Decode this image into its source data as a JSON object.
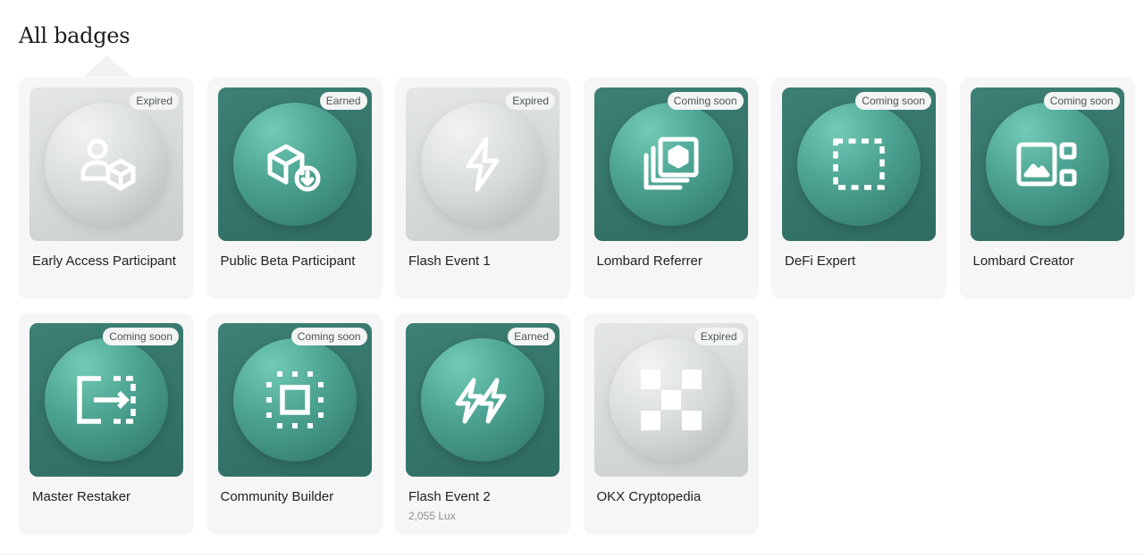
{
  "title": "All badges",
  "colors": {
    "accent": "#3d8074",
    "card_bg": "#f6f6f6",
    "pill_bg": "#f3f4f4"
  },
  "badges": [
    {
      "name": "Early Access Participant",
      "status": "Expired",
      "style": "grey",
      "icon": "user-cube-icon"
    },
    {
      "name": "Public Beta Participant",
      "status": "Earned",
      "style": "green",
      "icon": "box-download-icon"
    },
    {
      "name": "Flash Event 1",
      "status": "Expired",
      "style": "grey",
      "icon": "lightning-icon"
    },
    {
      "name": "Lombard Referrer",
      "status": "Coming soon",
      "style": "green",
      "icon": "stacked-cards-icon"
    },
    {
      "name": "DeFi Expert",
      "status": "Coming soon",
      "style": "green",
      "icon": "dashed-square-icon"
    },
    {
      "name": "Lombard Creator",
      "status": "Coming soon",
      "style": "green",
      "icon": "image-grid-icon"
    },
    {
      "name": "Master Restaker",
      "status": "Coming soon",
      "style": "green",
      "icon": "restake-arrow-icon"
    },
    {
      "name": "Community Builder",
      "status": "Coming soon",
      "style": "green",
      "icon": "chip-icon"
    },
    {
      "name": "Flash Event 2",
      "status": "Earned",
      "style": "green",
      "icon": "double-lightning-icon",
      "reward": "2,055 Lux"
    },
    {
      "name": "OKX Cryptopedia",
      "status": "Expired",
      "style": "grey",
      "icon": "okx-logo-icon"
    }
  ]
}
